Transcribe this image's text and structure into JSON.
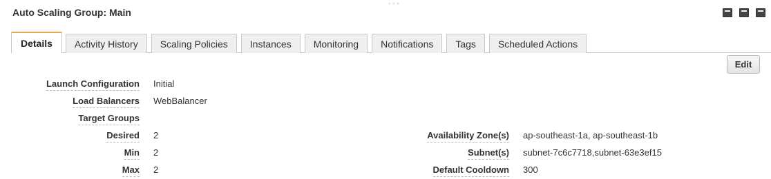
{
  "panel": {
    "title": "Auto Scaling Group: Main",
    "drag_handle": "◦◦◦"
  },
  "window_controls": [
    "minimize-panel",
    "split-panel",
    "maximize-panel"
  ],
  "tabs": [
    {
      "label": "Details",
      "active": true
    },
    {
      "label": "Activity History",
      "active": false
    },
    {
      "label": "Scaling Policies",
      "active": false
    },
    {
      "label": "Instances",
      "active": false
    },
    {
      "label": "Monitoring",
      "active": false
    },
    {
      "label": "Notifications",
      "active": false
    },
    {
      "label": "Tags",
      "active": false
    },
    {
      "label": "Scheduled Actions",
      "active": false
    }
  ],
  "actions": {
    "edit_label": "Edit"
  },
  "details_left": [
    {
      "label": "Launch Configuration",
      "value": "Initial"
    },
    {
      "label": "Load Balancers",
      "value": "WebBalancer"
    },
    {
      "label": "Target Groups",
      "value": ""
    },
    {
      "label": "Desired",
      "value": "2"
    },
    {
      "label": "Min",
      "value": "2"
    },
    {
      "label": "Max",
      "value": "2"
    }
  ],
  "details_right": [
    {
      "label": "Availability Zone(s)",
      "value": "ap-southeast-1a, ap-southeast-1b"
    },
    {
      "label": "Subnet(s)",
      "value": "subnet-7c6c7718,subnet-63e3ef15"
    },
    {
      "label": "Default Cooldown",
      "value": "300"
    }
  ],
  "colors": {
    "active_tab_accent": "#e8a64e",
    "tab_background": "#efefef",
    "border": "#c8c8c8"
  }
}
